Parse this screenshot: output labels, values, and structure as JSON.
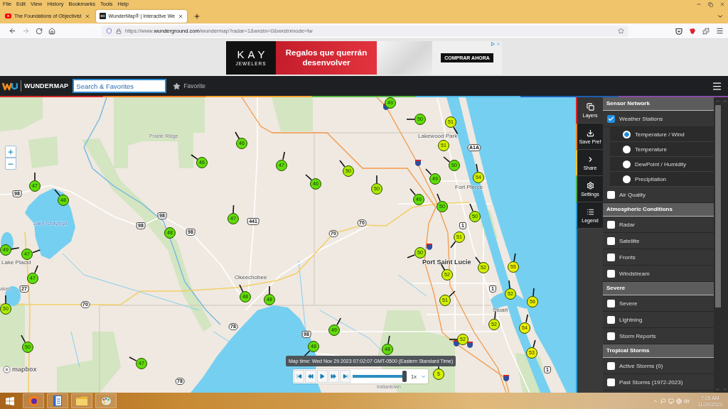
{
  "browser": {
    "menu": [
      "File",
      "Edit",
      "View",
      "History",
      "Bookmarks",
      "Tools",
      "Help"
    ],
    "tabs": [
      {
        "title": "The Foundations of Objectivist",
        "selected": false
      },
      {
        "title": "WunderMap® | Interactive We",
        "selected": true
      }
    ],
    "address": {
      "scheme": "https://www.",
      "host": "wunderground.com",
      "path": "/wundermap?radar=1&wxstn=0&wxstnmode=tw"
    }
  },
  "ad": {
    "brand": "KAY",
    "brand_sub": "JEWELERS",
    "headline": "Regalos que querrán desenvolver",
    "cta": "COMPRAR AHORA"
  },
  "toolbar": {
    "logo_text": "WUNDERMAP",
    "search": {
      "placeholder": "Search & Favorites"
    },
    "favorite": "Favorite"
  },
  "map": {
    "place_labels": [
      {
        "text": "Prairie Ridge",
        "kind": "town"
      },
      {
        "text": "Lake Istokpoga",
        "kind": "water"
      },
      {
        "text": "Lake Placid",
        "kind": "city"
      },
      {
        "text": "akes",
        "kind": "town"
      },
      {
        "text": "Okeechobee",
        "kind": "city"
      },
      {
        "text": "Lakewood Park",
        "kind": "city"
      },
      {
        "text": "Fort Pierce",
        "kind": "city"
      },
      {
        "text": "Port Saint Lucie",
        "kind": "major"
      },
      {
        "text": "Stuart",
        "kind": "city"
      },
      {
        "text": "Indiantown",
        "kind": "town"
      }
    ],
    "route_shields": [
      {
        "label": "98",
        "kind": "us"
      },
      {
        "label": "98",
        "kind": "us"
      },
      {
        "label": "98",
        "kind": "us"
      },
      {
        "label": "98",
        "kind": "us"
      },
      {
        "label": "441",
        "kind": "us"
      },
      {
        "label": "27",
        "kind": "us"
      },
      {
        "label": "70",
        "kind": "state"
      },
      {
        "label": "78",
        "kind": "state"
      },
      {
        "label": "78",
        "kind": "state"
      },
      {
        "label": "A1A",
        "kind": "state"
      },
      {
        "label": "70",
        "kind": "state"
      },
      {
        "label": "70",
        "kind": "state"
      },
      {
        "label": "1",
        "kind": "us"
      },
      {
        "label": "1",
        "kind": "us"
      },
      {
        "label": "98",
        "kind": "us"
      },
      {
        "label": "1",
        "kind": "us"
      }
    ],
    "stations": [
      {
        "temp": "46",
        "color": "#5fdc0a"
      },
      {
        "temp": "46",
        "color": "#5fdc0a"
      },
      {
        "temp": "47",
        "color": "#5fdc0a"
      },
      {
        "temp": "47",
        "color": "#5fdc0a"
      },
      {
        "temp": "48",
        "color": "#5fdc0a"
      },
      {
        "temp": "47",
        "color": "#5fdc0a"
      },
      {
        "temp": "48",
        "color": "#5fdc0a"
      },
      {
        "temp": "49",
        "color": "#5fdc0a"
      },
      {
        "temp": "47",
        "color": "#5fdc0a"
      },
      {
        "temp": "47",
        "color": "#5fdc0a"
      },
      {
        "temp": "50",
        "color": "#a9ea00"
      },
      {
        "temp": "50",
        "color": "#5fdc0a"
      },
      {
        "temp": "47",
        "color": "#5fdc0a"
      },
      {
        "temp": "48",
        "color": "#5fdc0a"
      },
      {
        "temp": "48",
        "color": "#5fdc0a"
      },
      {
        "temp": "49",
        "color": "#5fdc0a"
      },
      {
        "temp": "50",
        "color": "#5fdc0a"
      },
      {
        "temp": "51",
        "color": "#d4ef00"
      },
      {
        "temp": "51",
        "color": "#d4ef00"
      },
      {
        "temp": "50",
        "color": "#5fdc0a"
      },
      {
        "temp": "54",
        "color": "#d4ef00"
      },
      {
        "temp": "50",
        "color": "#a9ea00"
      },
      {
        "temp": "46",
        "color": "#5fdc0a"
      },
      {
        "temp": "49",
        "color": "#5fdc0a"
      },
      {
        "temp": "50",
        "color": "#a9ea00"
      },
      {
        "temp": "49",
        "color": "#5fdc0a"
      },
      {
        "temp": "50",
        "color": "#5fdc0a"
      },
      {
        "temp": "50",
        "color": "#a9ea00"
      },
      {
        "temp": "51",
        "color": "#d4ef00"
      },
      {
        "temp": "50",
        "color": "#a9ea00"
      },
      {
        "temp": "52",
        "color": "#d4ef00"
      },
      {
        "temp": "52",
        "color": "#d4ef00"
      },
      {
        "temp": "55",
        "color": "#ecee00"
      },
      {
        "temp": "52",
        "color": "#d4ef00"
      },
      {
        "temp": "51",
        "color": "#d4ef00"
      },
      {
        "temp": "56",
        "color": "#ecee00"
      },
      {
        "temp": "52",
        "color": "#d4ef00"
      },
      {
        "temp": "54",
        "color": "#ecee00"
      },
      {
        "temp": "49",
        "color": "#5fdc0a"
      },
      {
        "temp": "48",
        "color": "#5fdc0a"
      },
      {
        "temp": "52",
        "color": "#d4ef00"
      },
      {
        "temp": "53",
        "color": "#ecee00"
      },
      {
        "temp": "48",
        "color": "#5fdc0a"
      },
      {
        "temp": "5",
        "color": "#d4ef00"
      }
    ],
    "attribution": "mapbox",
    "time_tooltip": "Map time: Wed Nov 29 2023 07:02:07 GMT-0500 (Eastern Standard Time)",
    "playback": {
      "level": 1,
      "speed": "1x"
    }
  },
  "side_tabs": [
    {
      "label": "Layers",
      "selected": true
    },
    {
      "label": "Save Pref",
      "selected": false
    },
    {
      "label": "Share",
      "selected": false
    },
    {
      "label": "Settings",
      "selected": false
    },
    {
      "label": "Legend",
      "selected": false
    }
  ],
  "layers": {
    "sections": [
      {
        "title": "Sensor Network",
        "items": [
          {
            "label": "Weather Stations",
            "checked": true,
            "options": [
              {
                "label": "Temperature / Wind",
                "selected": true
              },
              {
                "label": "Temperature",
                "selected": false
              },
              {
                "label": "DewPoint / Humidity",
                "selected": false
              },
              {
                "label": "Precipitation",
                "selected": false
              }
            ]
          },
          {
            "label": "Air Quality",
            "checked": false
          }
        ]
      },
      {
        "title": "Atmospheric Conditions",
        "items": [
          {
            "label": "Radar",
            "checked": false
          },
          {
            "label": "Satellite",
            "checked": false
          },
          {
            "label": "Fronts",
            "checked": false
          },
          {
            "label": "Windstream",
            "checked": false
          }
        ]
      },
      {
        "title": "Severe",
        "items": [
          {
            "label": "Severe",
            "checked": false
          },
          {
            "label": "Lightning",
            "checked": false
          },
          {
            "label": "Storm Reports",
            "checked": false
          }
        ]
      },
      {
        "title": "Tropical Storms",
        "items": [
          {
            "label": "Active Storms (0)",
            "checked": false
          },
          {
            "label": "Past Storms (1972-2023)",
            "checked": false
          }
        ]
      }
    ]
  },
  "taskbar": {
    "time": "7:05 AM",
    "date": "11/29/2023"
  }
}
